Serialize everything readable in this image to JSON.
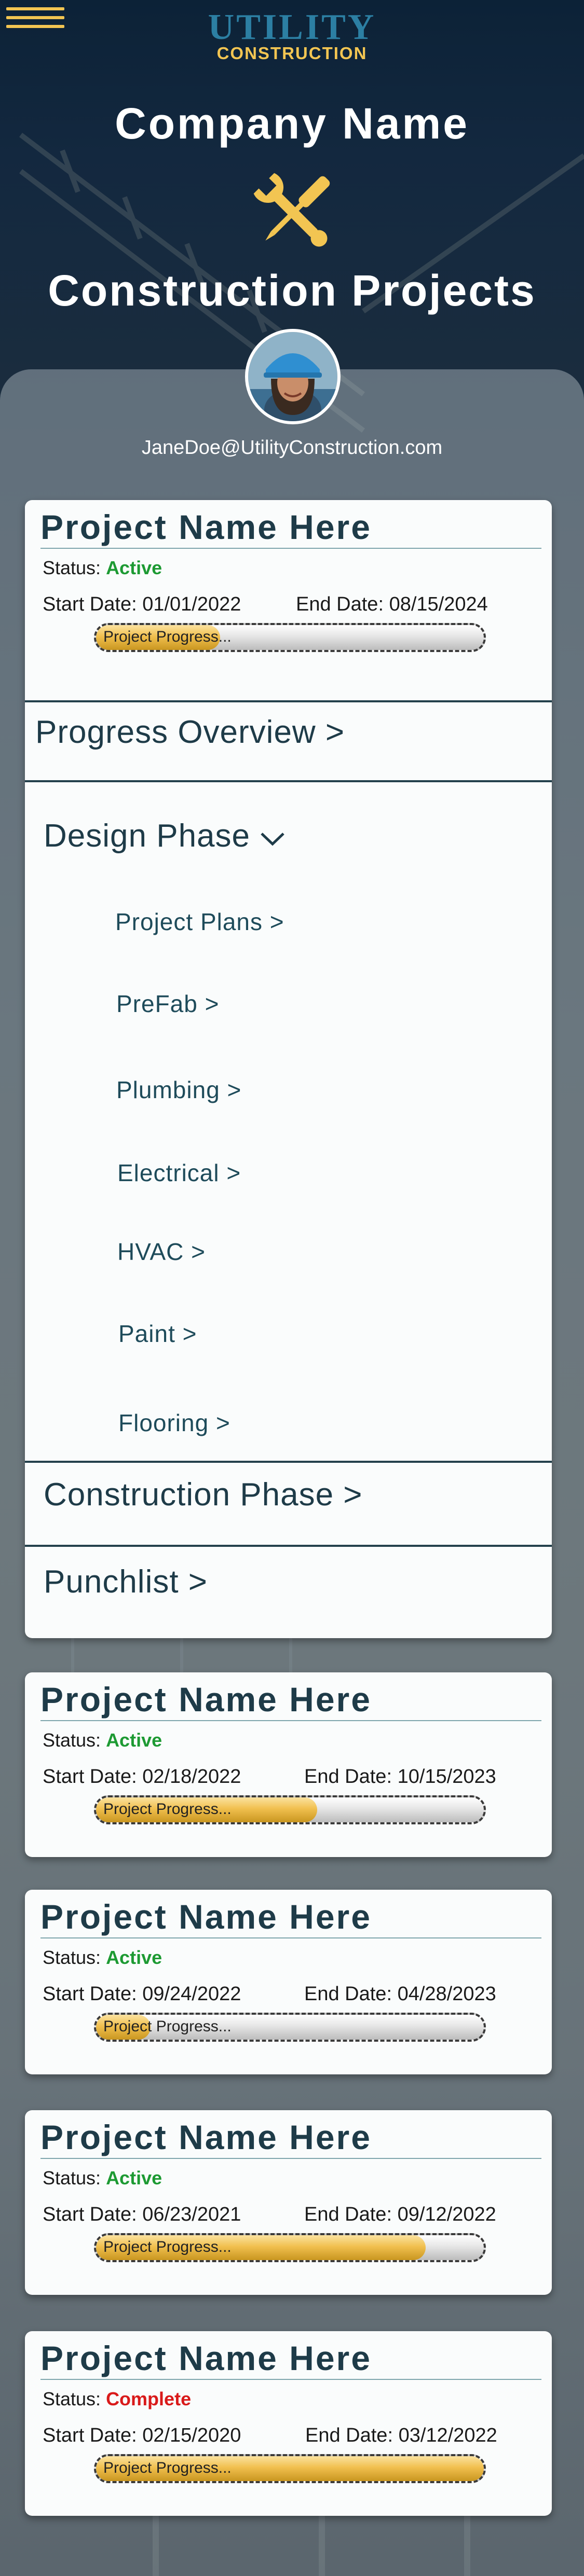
{
  "header": {
    "logo_top": "UTILITY",
    "logo_bottom": "CONSTRUCTION",
    "company_name": "Company Name",
    "page_title": "Construction Projects"
  },
  "user": {
    "email": "JaneDoe@UtilityConstruction.com"
  },
  "labels": {
    "status_prefix": "Status: ",
    "start_prefix": "Start Date: ",
    "end_prefix": "End Date: ",
    "progress_label": "Project Progress..."
  },
  "projects": [
    {
      "name": "Project Name Here",
      "status": "Active",
      "start": "01/01/2022",
      "end": "08/15/2024",
      "progress": 0.32
    },
    {
      "name": "Project Name Here",
      "status": "Active",
      "start": "02/18/2022",
      "end": "10/15/2023",
      "progress": 0.57
    },
    {
      "name": "Project Name Here",
      "status": "Active",
      "start": "09/24/2022",
      "end": "04/28/2023",
      "progress": 0.14
    },
    {
      "name": "Project Name Here",
      "status": "Active",
      "start": "06/23/2021",
      "end": "09/12/2022",
      "progress": 0.85
    },
    {
      "name": "Project Name Here",
      "status": "Complete",
      "start": "02/15/2020",
      "end": "03/12/2022",
      "progress": 1.0
    }
  ],
  "accordion": {
    "progress_overview": "Progress Overview >",
    "design_phase": "Design Phase",
    "design_items": [
      "Project Plans >",
      "PreFab >",
      "Plumbing >",
      "Electrical >",
      "HVAC >",
      "Paint >",
      "Flooring >"
    ],
    "construction_phase": "Construction Phase >",
    "punchlist": "Punchlist >"
  },
  "colors": {
    "accent_gold": "#f2c552",
    "active": "#1d9a33",
    "complete": "#d91a1a",
    "title": "#1e3b48"
  }
}
